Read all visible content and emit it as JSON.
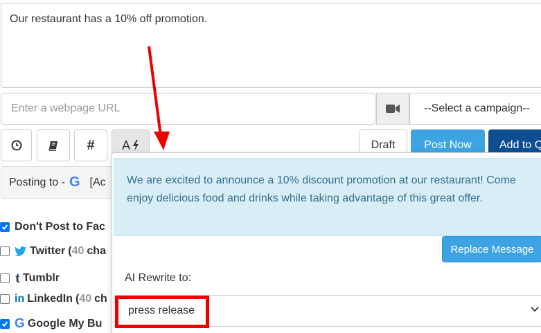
{
  "message": {
    "text": "Our restaurant has a 10% off promotion."
  },
  "url_input": {
    "placeholder": "Enter a webpage URL"
  },
  "campaign_select": {
    "value": "--Select a campaign--"
  },
  "toolbar": {
    "ai_label": "A",
    "draft_label": "Draft",
    "post_now_label": "Post Now",
    "add_to_label": "Add to Q"
  },
  "posting_to": {
    "prefix": "Posting to -",
    "g_logo": "G",
    "suffix": "[Ac"
  },
  "networks": [
    {
      "label": "Don't Post to Fac",
      "checked": true,
      "icon": "none"
    },
    {
      "label": "Twitter",
      "count_prefix": "(",
      "count": "40",
      "count_suffix": "cha",
      "checked": false,
      "icon": "twitter-icon"
    },
    {
      "label": "Tumblr",
      "checked": false,
      "icon": "tumblr-icon",
      "icon_text": "t"
    },
    {
      "label": "LinkedIn",
      "count_prefix": "(",
      "count": "40",
      "count_suffix": "ch",
      "checked": false,
      "icon": "linkedin-icon",
      "icon_text": "in"
    },
    {
      "label": "Google My Bu",
      "checked": true,
      "icon": "google-icon",
      "icon_text": "G"
    }
  ],
  "ai_popup": {
    "suggestion": "We are excited to announce a 10% discount promotion at our restaurant! Come enjoy delicious food and drinks while taking advantage of this great offer.",
    "replace_label": "Replace Message",
    "rewrite_label": "AI Rewrite to:",
    "rewrite_value": "press release"
  },
  "colors": {
    "primary": "#3ea3e3",
    "dark_blue": "#0e4d92",
    "alert_bg": "#d9edf7",
    "alert_text": "#31708f",
    "annotation": "#ee0000"
  }
}
